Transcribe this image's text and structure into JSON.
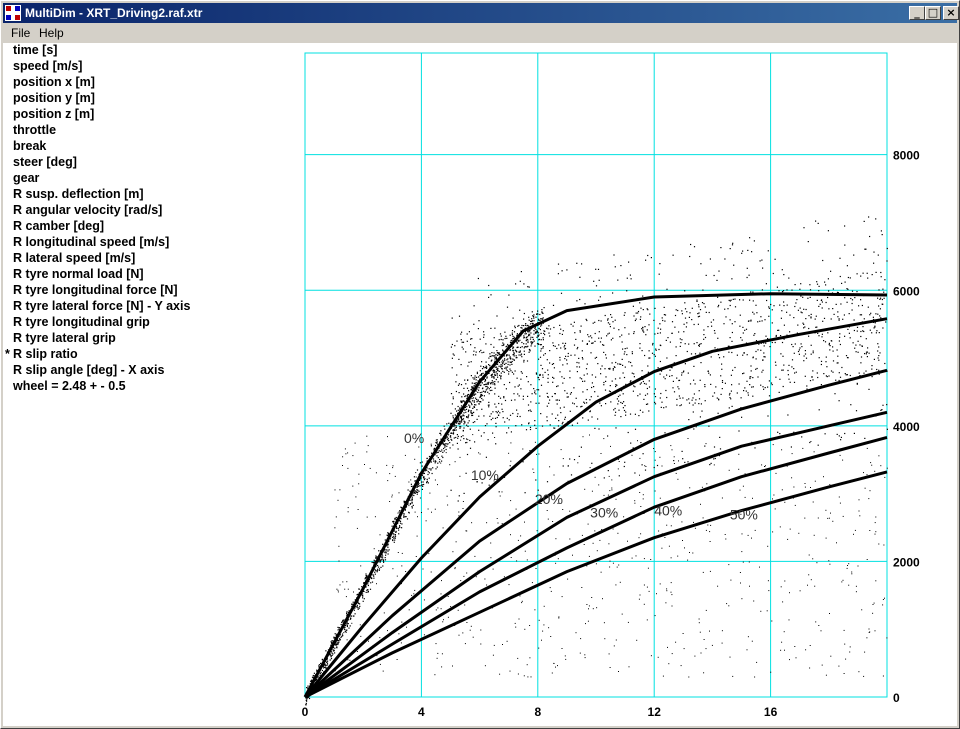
{
  "window": {
    "title": "MultiDim - XRT_Driving2.raf.xtr",
    "buttons": {
      "minimize": "_",
      "maximize": "□",
      "close": "×"
    }
  },
  "menu": {
    "file": "File",
    "help": "Help"
  },
  "variables": {
    "items": [
      "time [s]",
      "speed [m/s]",
      "position x [m]",
      "position y [m]",
      "position z [m]",
      "throttle",
      "break",
      "steer [deg]",
      "gear",
      "R susp. deflection [m]",
      "R angular velocity [rad/s]",
      "R camber [deg]",
      "R longitudinal speed [m/s]",
      "R lateral speed [m/s]",
      "R tyre normal load [N]",
      "R tyre longitudinal force [N]",
      "R tyre lateral force [N] - Y axis",
      "R tyre longitudinal grip",
      "R tyre lateral grip",
      "R slip ratio",
      "R slip angle [deg] - X axis",
      "wheel = 2.48 + - 0.5"
    ],
    "selected_index": 19,
    "selected_marker": "*"
  },
  "chart_data": {
    "type": "line",
    "xlim": [
      0,
      20
    ],
    "ylim": [
      0,
      9500
    ],
    "x_ticks": [
      0,
      4,
      8,
      12,
      16
    ],
    "y_ticks": [
      0,
      2000,
      4000,
      6000,
      8000
    ],
    "grid": true,
    "grid_color": "#00e0e0",
    "series": [
      {
        "name": "0%",
        "label_at": [
          3.4,
          3750
        ],
        "points": [
          [
            0,
            0
          ],
          [
            2,
            1600
          ],
          [
            4,
            3300
          ],
          [
            6,
            4650
          ],
          [
            7.5,
            5400
          ],
          [
            9,
            5700
          ],
          [
            12,
            5900
          ],
          [
            16,
            5950
          ],
          [
            20,
            5930
          ]
        ]
      },
      {
        "name": "10%",
        "label_at": [
          5.7,
          3200
        ],
        "points": [
          [
            0,
            0
          ],
          [
            2,
            1050
          ],
          [
            4,
            2050
          ],
          [
            6,
            2950
          ],
          [
            8,
            3700
          ],
          [
            10,
            4350
          ],
          [
            12,
            4800
          ],
          [
            14,
            5100
          ],
          [
            17,
            5350
          ],
          [
            20,
            5580
          ]
        ]
      },
      {
        "name": "20%",
        "label_at": [
          7.9,
          2850
        ],
        "points": [
          [
            0,
            0
          ],
          [
            3,
            1200
          ],
          [
            6,
            2300
          ],
          [
            9,
            3150
          ],
          [
            12,
            3800
          ],
          [
            15,
            4250
          ],
          [
            18,
            4600
          ],
          [
            20,
            4820
          ]
        ]
      },
      {
        "name": "30%",
        "label_at": [
          9.8,
          2650
        ],
        "points": [
          [
            0,
            0
          ],
          [
            3,
            950
          ],
          [
            6,
            1850
          ],
          [
            9,
            2650
          ],
          [
            12,
            3250
          ],
          [
            15,
            3700
          ],
          [
            18,
            4000
          ],
          [
            20,
            4200
          ]
        ]
      },
      {
        "name": "40%",
        "label_at": [
          12,
          2680
        ],
        "points": [
          [
            0,
            0
          ],
          [
            3,
            780
          ],
          [
            6,
            1550
          ],
          [
            9,
            2200
          ],
          [
            12,
            2800
          ],
          [
            15,
            3250
          ],
          [
            18,
            3600
          ],
          [
            20,
            3830
          ]
        ]
      },
      {
        "name": "50%",
        "label_at": [
          14.6,
          2620
        ],
        "points": [
          [
            0,
            0
          ],
          [
            3,
            650
          ],
          [
            6,
            1250
          ],
          [
            9,
            1850
          ],
          [
            12,
            2350
          ],
          [
            15,
            2750
          ],
          [
            18,
            3100
          ],
          [
            20,
            3320
          ]
        ]
      }
    ],
    "scatter_color": "#000000",
    "curve_color": "#000000"
  }
}
